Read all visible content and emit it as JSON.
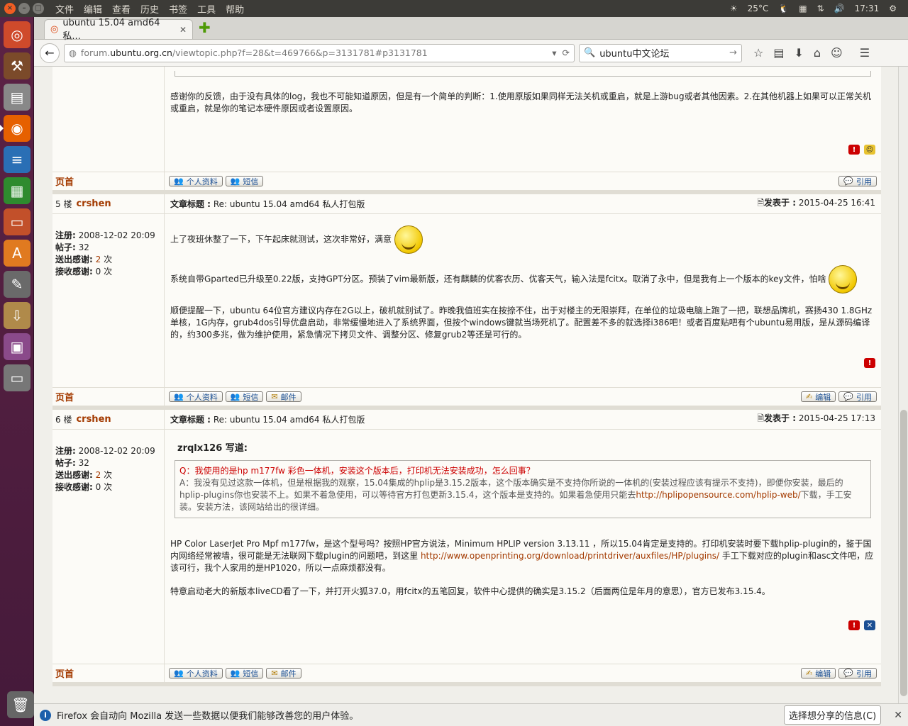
{
  "menubar": {
    "items": [
      "文件",
      "编辑",
      "查看",
      "历史",
      "书签",
      "工具",
      "帮助"
    ]
  },
  "indicators": {
    "weather": "25°C",
    "time": "17:31"
  },
  "tab": {
    "title": "ubuntu 15.04 amd64 私..."
  },
  "url": {
    "prefix": "forum.",
    "host": "ubuntu.org.cn",
    "path": "/viewtopic.php?f=28&t=469766&p=3131781#p3131781"
  },
  "search": {
    "value": "ubuntu中文论坛"
  },
  "labels": {
    "top": "页首",
    "profile": "个人资料",
    "pm": "短信",
    "email": "邮件",
    "edit": "编辑",
    "quote": "引用",
    "subject": "文章标题 :",
    "posted": "发表于 :",
    "reg": "注册:",
    "posts": "帖子:",
    "thanks_sent": "送出感谢:",
    "thanks_recv": "接收感谢:",
    "times": "次"
  },
  "post4": {
    "text": "感谢你的反馈，由于没有具体的log，我也不可能知道原因，但是有一个简单的判断：1.使用原版如果同样无法关机或重启，就是上游bug或者其他因素。2.在其他机器上如果可以正常关机或重启，就是你的笔记本硬件原因或者设置原因。"
  },
  "post5": {
    "floor": "5 楼",
    "user": "crshen",
    "subject": "Re: ubuntu 15.04 amd64 私人打包版",
    "time": "2015-04-25 16:41",
    "reg": "2008-12-02 20:09",
    "posts": "32",
    "thanks_sent": "2",
    "thanks_recv": "0",
    "p1": "上了夜班休整了一下，下午起床就测试，这次非常好，满意",
    "p2": "系统自带Gparted已升级至0.22版，支持GPT分区。预装了vim最新版，还有麒麟的优客农历、优客天气，输入法是fcitx。取消了永中，但是我有上一个版本的key文件，怕啥",
    "p3": "顺便提醒一下，ubuntu 64位官方建议内存在2G以上，破机就别试了。昨晚我值班实在按捺不住，出于对楼主的无限崇拜，在单位的垃圾电脑上跑了一把，联想品牌机，赛扬430 1.8GHz单核，1G内存，grub4dos引导优盘启动，非常缓慢地进入了系统界面，但按个windows键就当场死机了。配置差不多的就选择i386吧！或者百度贴吧有个ubuntu易用版，是从源码编译的，约300多兆，做为维护使用，紧急情况下拷贝文件、调整分区、修复grub2等还是可行的。"
  },
  "post6": {
    "floor": "6 楼",
    "user": "crshen",
    "subject": "Re: ubuntu 15.04 amd64 私人打包版",
    "time": "2015-04-25 17:13",
    "reg": "2008-12-02 20:09",
    "posts": "32",
    "thanks_sent": "2",
    "thanks_recv": "0",
    "quote_author": "zrqlx126 写道:",
    "q_line": "Q：我使用的是hp m177fw 彩色一体机，安装这个版本后，打印机无法安装成功，怎么回事？",
    "a_line1": "A：我没有见过这款一体机，但是根据我的观察，15.04集成的hplip是3.15.2版本，这个版本确实是不支持你所说的一体机的(安装过程应该有提示不支持)，即便你安装，最后的hplip-plugins你也安装不上。如果不着急使用，可以等待官方打包更新3.15.4，这个版本是支持的。如果着急使用只能去",
    "a_link": "http://hplipopensource.com/hplip-web/",
    "a_line2": "下载，手工安装。安装方法，该网站给出的很详细。",
    "p1a": "HP Color LaserJet Pro Mpf m177fw，是这个型号吗？按照HP官方说法，Minimum HPLIP version 3.13.11 ，所以15.04肯定是支持的。打印机安装时要下载hplip-plugin的，鉴于国内网络经常被墙，很可能是无法联网下载plugin的问题吧，到这里 ",
    "p1link": "http://www.openprinting.org/download/printdriver/auxfiles/HP/plugins/",
    "p1b": " 手工下载对应的plugin和asc文件吧，应该可行，我个人家用的是HP1020，所以一点麻烦都没有。",
    "p2": "特意启动老大的新版本liveCD看了一下，并打开火狐37.0，用fcitx的五笔回复，软件中心提供的确实是3.15.2（后面两位是年月的意思），官方已发布3.15.4。"
  },
  "notification": {
    "text": "Firefox 会自动向 Mozilla 发送一些数据以便我们能够改善您的用户体验。",
    "button": "选择想分享的信息(C)"
  }
}
